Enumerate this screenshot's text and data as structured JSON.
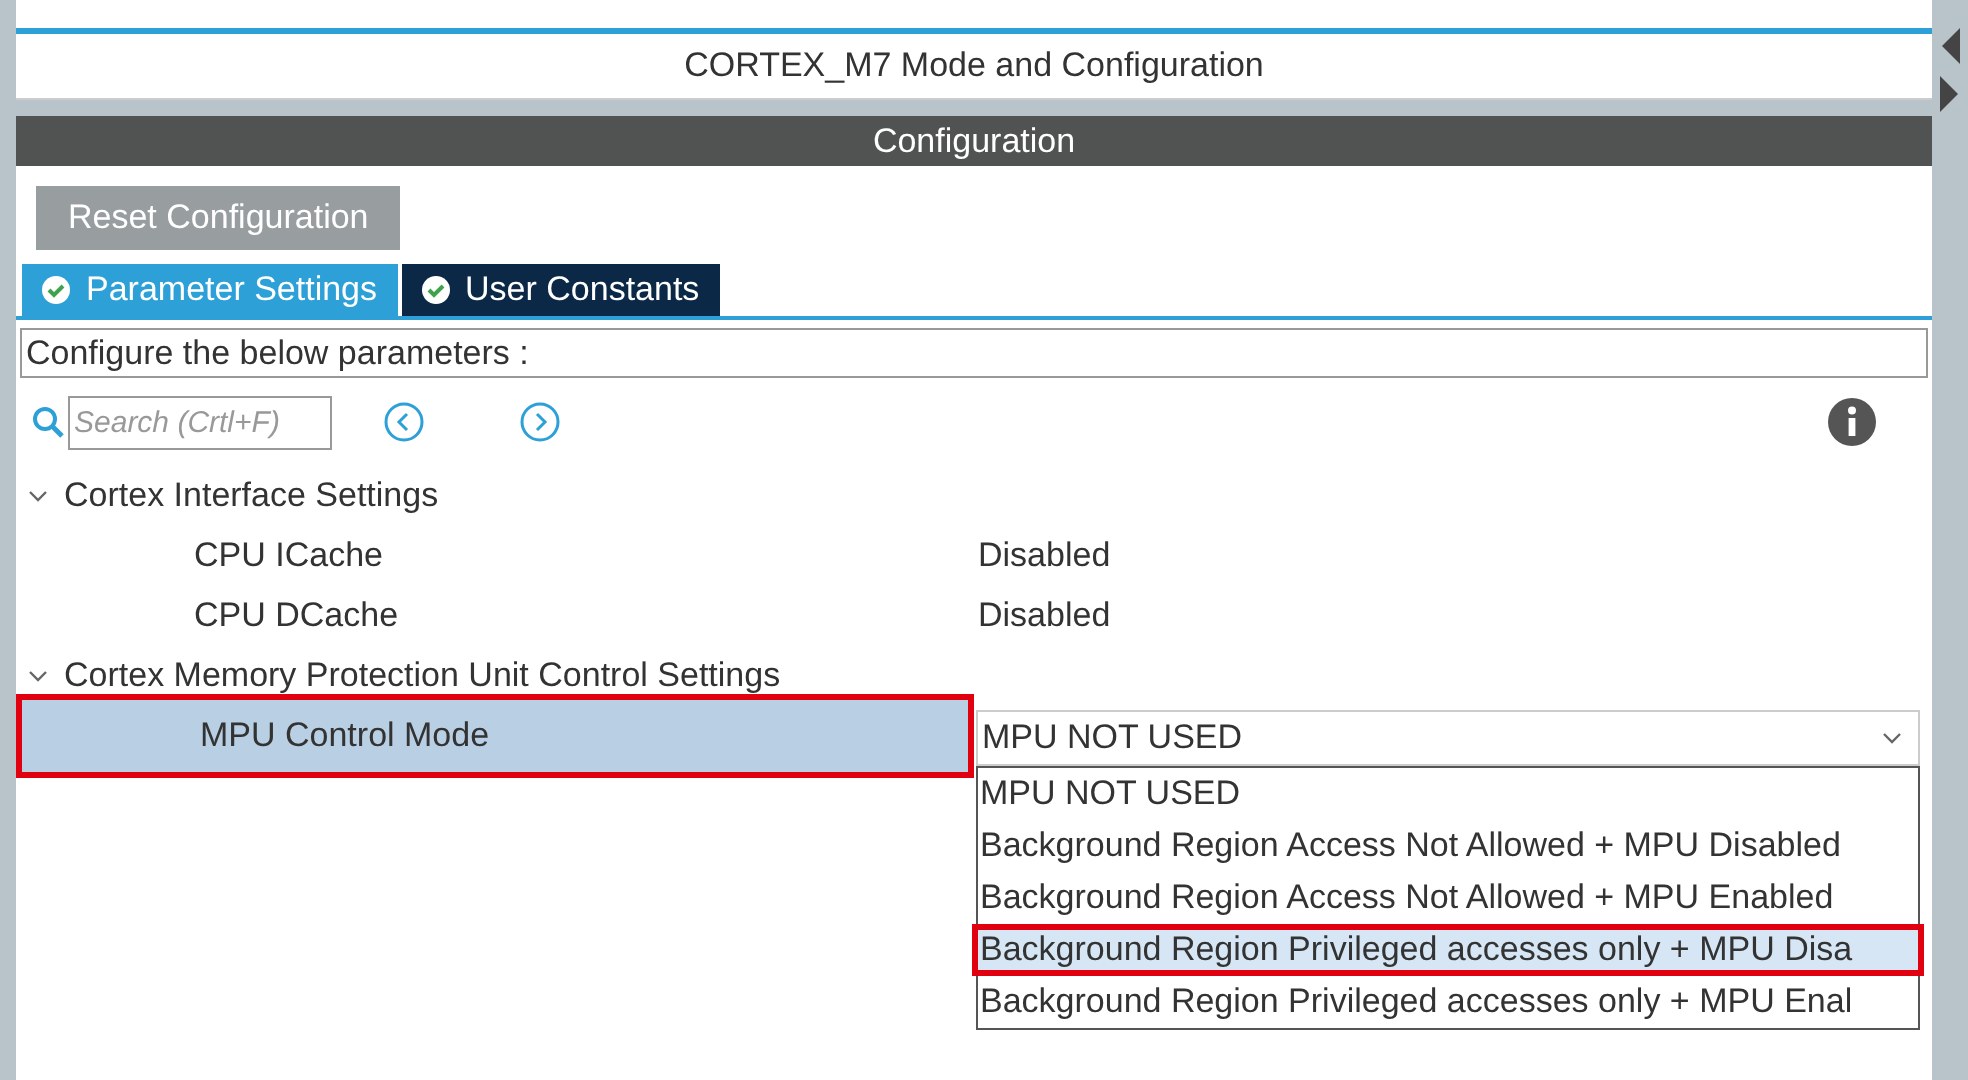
{
  "window": {
    "title": "CORTEX_M7 Mode and Configuration"
  },
  "section_header": "Configuration",
  "reset_button": "Reset Configuration",
  "tabs": [
    {
      "label": "Parameter Settings",
      "selected": true
    },
    {
      "label": "User Constants",
      "selected": false
    }
  ],
  "description": "Configure the below parameters :",
  "search": {
    "placeholder": "Search (Crtl+F)"
  },
  "tree": [
    {
      "label": "Cortex Interface Settings",
      "expanded": true,
      "children": [
        {
          "label": "CPU ICache",
          "value": "Disabled",
          "selected": false,
          "annotated": false
        },
        {
          "label": "CPU DCache",
          "value": "Disabled",
          "selected": false,
          "annotated": false
        }
      ]
    },
    {
      "label": "Cortex Memory Protection Unit Control Settings",
      "expanded": true,
      "children": [
        {
          "label": "MPU Control Mode",
          "value": "MPU NOT USED",
          "selected": true,
          "annotated": true
        }
      ]
    }
  ],
  "dropdown": {
    "open": true,
    "options": [
      {
        "label": "MPU NOT USED",
        "selected": false,
        "annotated": false
      },
      {
        "label": "Background Region Access Not Allowed + MPU Disabled",
        "selected": false,
        "annotated": false
      },
      {
        "label": "Background Region Access Not Allowed + MPU Enabled",
        "selected": false,
        "annotated": false
      },
      {
        "label": "Background Region Privileged accesses only + MPU Disa",
        "selected": true,
        "annotated": true
      },
      {
        "label": "Background Region Privileged accesses only + MPU Enal",
        "selected": false,
        "annotated": false
      }
    ]
  }
}
